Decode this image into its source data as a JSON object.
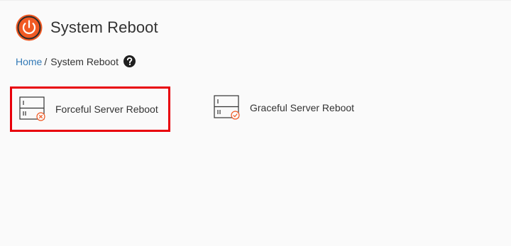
{
  "header": {
    "title": "System Reboot",
    "icon": "power-icon",
    "accent_color": "#f15a24"
  },
  "breadcrumb": {
    "home_label": "Home",
    "separator": "/",
    "current_label": "System Reboot",
    "help_icon": "question-circle-icon"
  },
  "tiles": [
    {
      "label": "Forceful Server Reboot",
      "icon": "server-error-icon",
      "highlighted": true,
      "highlight_color": "#e8000a"
    },
    {
      "label": "Graceful Server Reboot",
      "icon": "server-check-icon",
      "highlighted": false
    }
  ],
  "colors": {
    "background": "#fafafa",
    "link": "#337ab7",
    "text": "#333333",
    "badge": "#f15a24"
  }
}
